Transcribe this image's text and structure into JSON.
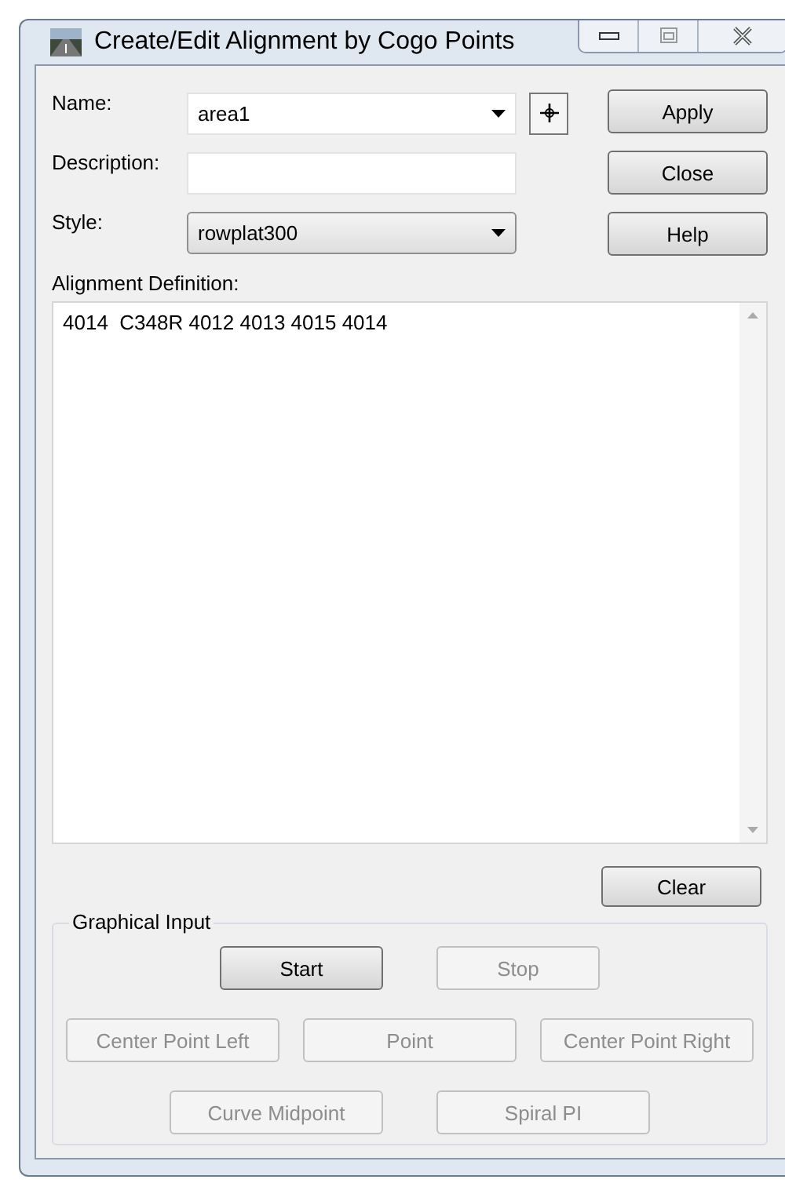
{
  "window": {
    "title": "Create/Edit Alignment by Cogo Points"
  },
  "fields": [
    {
      "label": "Name:",
      "kind": "combo",
      "value": "area1"
    },
    {
      "label": "Description:",
      "kind": "text"
    },
    {
      "label": "Style:",
      "kind": "dropdown",
      "value": "rowplat300"
    }
  ],
  "side_buttons": [
    {
      "label": "Apply",
      "disabled": false
    },
    {
      "label": "Close",
      "disabled": false
    },
    {
      "label": "Help",
      "disabled": false
    }
  ],
  "definition": {
    "label": "Alignment Definition:",
    "value": "4014  C348R 4012 4013 4015 4014"
  },
  "clear_button": {
    "label": "Clear",
    "disabled": false
  },
  "graphical_input": {
    "title": "Graphical Input",
    "rows": [
      [
        {
          "label": "Start",
          "disabled": false
        },
        {
          "label": "Stop",
          "disabled": true
        }
      ],
      [
        {
          "label": "Center Point Left",
          "disabled": true
        },
        {
          "label": "Point",
          "disabled": true
        },
        {
          "label": "Center Point Right",
          "disabled": true
        }
      ],
      [
        {
          "label": "Curve Midpoint",
          "disabled": true
        },
        {
          "label": "Spiral PI",
          "disabled": true
        }
      ]
    ]
  }
}
